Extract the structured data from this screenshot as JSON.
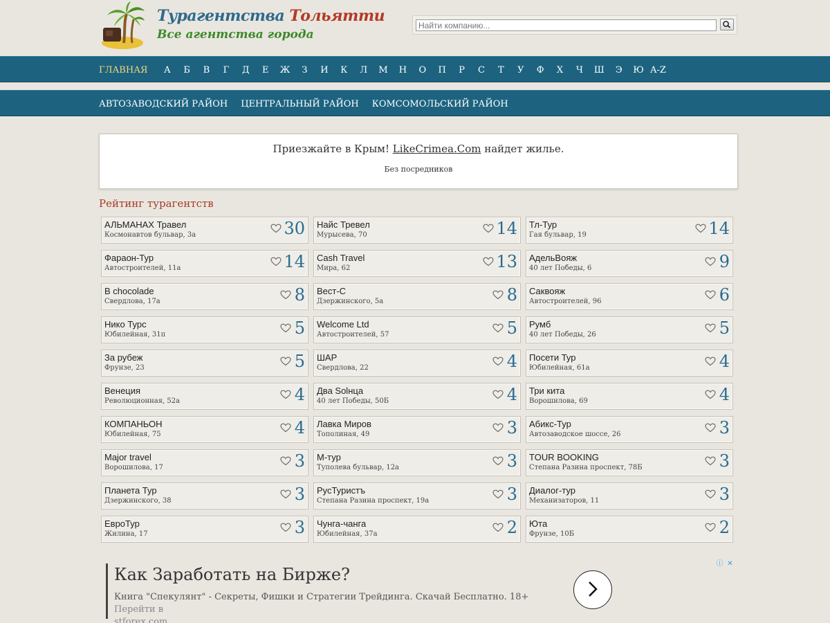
{
  "header": {
    "title_part1": "Турагентства",
    "title_part2": "Тольятти",
    "subtitle": "Все агентства города",
    "search_placeholder": "Найти компанию...",
    "logo_icon": "palm-island-icon",
    "search_icon": "magnifier-icon"
  },
  "nav_letters": {
    "home": "ГЛАВНАЯ",
    "letters": [
      "А",
      "Б",
      "В",
      "Г",
      "Д",
      "Е",
      "Ж",
      "З",
      "И",
      "К",
      "Л",
      "М",
      "Н",
      "О",
      "П",
      "Р",
      "С",
      "Т",
      "У",
      "Ф",
      "Х",
      "Ч",
      "Ш",
      "Э",
      "Ю",
      "A-Z"
    ]
  },
  "nav_districts": {
    "items": [
      "АВТОЗАВОДСКИЙ РАЙОН",
      "ЦЕНТРАЛЬНЫЙ РАЙОН",
      "КОМСОМОЛЬСКИЙ РАЙОН"
    ]
  },
  "promo": {
    "before": "Приезжайте в Крым! ",
    "link": "LikeCrimea.Com",
    "after": " найдет жилье.",
    "sub": "Без посредников"
  },
  "rating": {
    "title": "Рейтинг турагентств",
    "heart_icon": "heart-icon",
    "cards": [
      {
        "name": "АЛЬМАНАХ Травел",
        "addr": "Космонавтов бульвар, 3а",
        "score": "30"
      },
      {
        "name": "Найс Тревел",
        "addr": "Мурысева, 70",
        "score": "14"
      },
      {
        "name": "Тл-Тур",
        "addr": "Гая бульвар, 19",
        "score": "14"
      },
      {
        "name": "Фараон-Тур",
        "addr": "Автостроителей, 11а",
        "score": "14"
      },
      {
        "name": "Cash Travel",
        "addr": "Мира, 62",
        "score": "13"
      },
      {
        "name": "АдельВояж",
        "addr": "40 лет Победы, 6",
        "score": "9"
      },
      {
        "name": "B chocolade",
        "addr": "Свердлова, 17а",
        "score": "8"
      },
      {
        "name": "Вест-С",
        "addr": "Дзержинского, 5а",
        "score": "8"
      },
      {
        "name": "Саквояж",
        "addr": "Автостроителей, 96",
        "score": "6"
      },
      {
        "name": "Нико Турс",
        "addr": "Юбилейная, 31п",
        "score": "5"
      },
      {
        "name": "Welcome Ltd",
        "addr": "Автостроителей, 57",
        "score": "5"
      },
      {
        "name": "Румб",
        "addr": "40 лет Победы, 26",
        "score": "5"
      },
      {
        "name": "За рубеж",
        "addr": "Фрунзе, 23",
        "score": "5"
      },
      {
        "name": "ШАР",
        "addr": "Свердлова, 22",
        "score": "4"
      },
      {
        "name": "Посети Тур",
        "addr": "Юбилейная, 61а",
        "score": "4"
      },
      {
        "name": "Венеция",
        "addr": "Революционная, 52а",
        "score": "4"
      },
      {
        "name": "Два Solнца",
        "addr": "40 лет Победы, 50Б",
        "score": "4"
      },
      {
        "name": "Три кита",
        "addr": "Ворошилова, 69",
        "score": "4"
      },
      {
        "name": "КОМПАНЬОН",
        "addr": "Юбилейная, 75",
        "score": "4"
      },
      {
        "name": "Лавка Миров",
        "addr": "Тополиная, 49",
        "score": "3"
      },
      {
        "name": "Абикс-Тур",
        "addr": "Автозаводское шоссе, 26",
        "score": "3"
      },
      {
        "name": "Major travel",
        "addr": "Ворошилова, 17",
        "score": "3"
      },
      {
        "name": "М-тур",
        "addr": "Туполева бульвар, 12а",
        "score": "3"
      },
      {
        "name": "TOUR BOOKING",
        "addr": "Степана Разина проспект, 78Б",
        "score": "3"
      },
      {
        "name": "Планета Тур",
        "addr": "Дзержинского, 38",
        "score": "3"
      },
      {
        "name": "РусТуристъ",
        "addr": "Степана Разина проспект, 19а",
        "score": "3"
      },
      {
        "name": "Диалог-тур",
        "addr": "Механизаторов, 11",
        "score": "3"
      },
      {
        "name": "ЕвроТур",
        "addr": "Жилина, 17",
        "score": "3"
      },
      {
        "name": "Чунга-чанга",
        "addr": "Юбилейная, 37а",
        "score": "2"
      },
      {
        "name": "Юта",
        "addr": "Фрунзе, 10Б",
        "score": "2"
      }
    ]
  },
  "ad": {
    "title": "Как Заработать на Бирже?",
    "desc": "Книга \"Спекулянт\" - Секреты, Фишки и Стратегии Трейдинга. Скачай Бесплатно. 18+",
    "go": "Перейти в",
    "domain": "stforex.com",
    "info_badge": "ⓘ",
    "close_badge": "✕",
    "arrow_icon": "chevron-right-icon"
  }
}
